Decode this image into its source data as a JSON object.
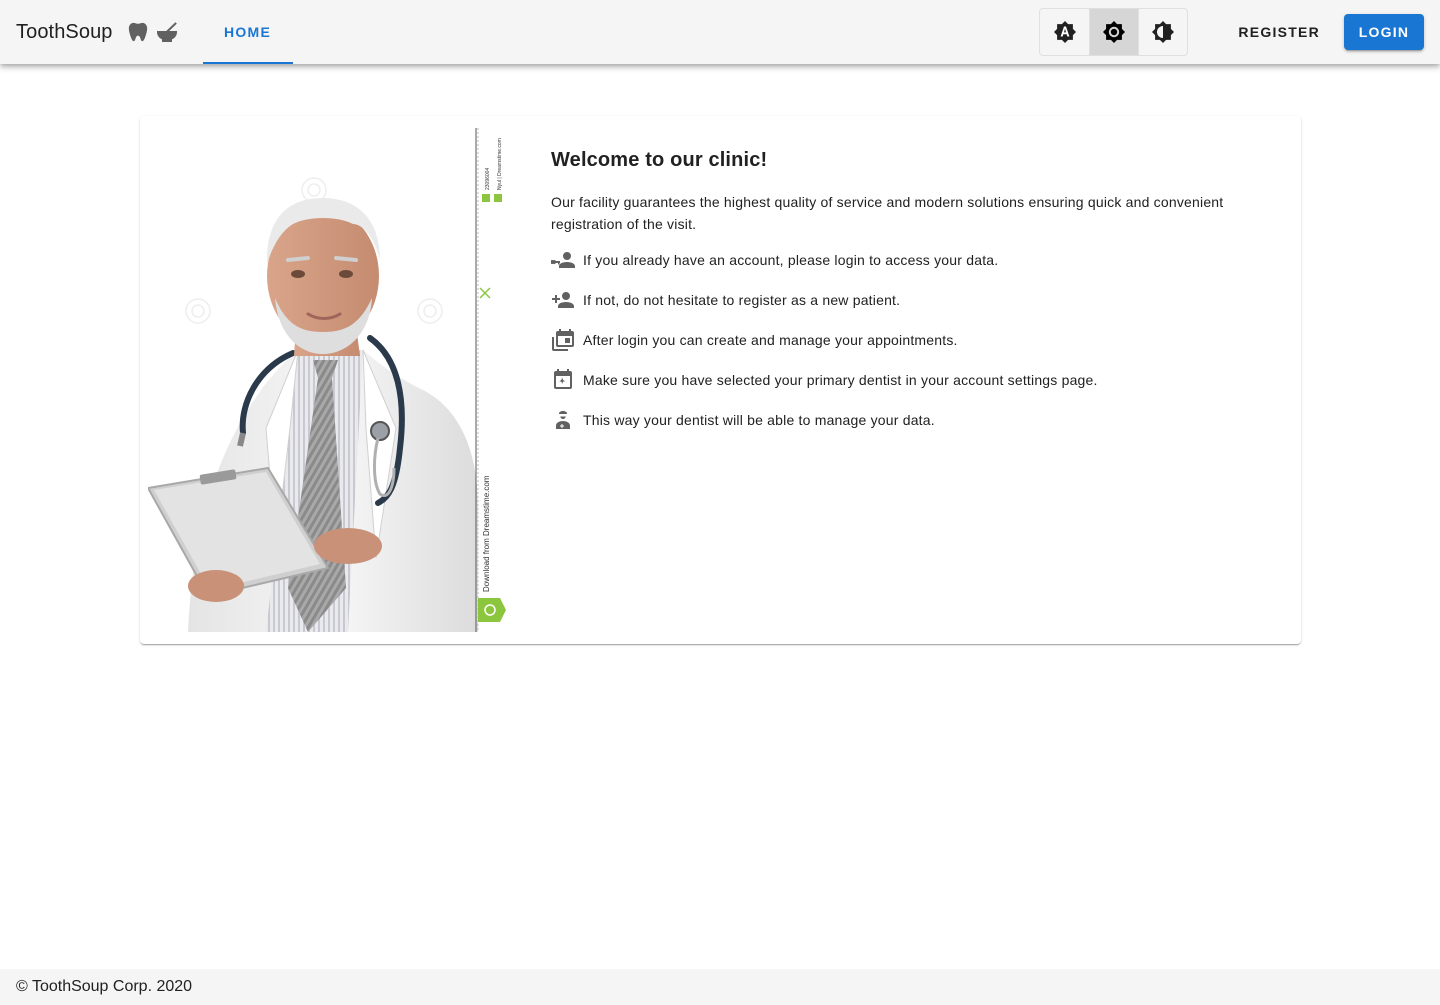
{
  "appbar": {
    "brand": "ToothSoup",
    "tabs": [
      {
        "label": "HOME",
        "active": true
      }
    ],
    "theme_options": [
      "auto",
      "light",
      "dark"
    ],
    "theme_selected": "light",
    "register_label": "REGISTER",
    "login_label": "LOGIN"
  },
  "welcome": {
    "title": "Welcome to our clinic!",
    "intro": "Our facility guarantees the highest quality of service and modern solutions ensuring quick and convenient registration of the visit.",
    "items": [
      {
        "icon": "account-key-icon",
        "text": "If you already have an account, please login to access your data."
      },
      {
        "icon": "account-plus-icon",
        "text": "If not, do not hesitate to register as a new patient."
      },
      {
        "icon": "calendar-multiple-icon",
        "text": "After login you can create and manage your appointments."
      },
      {
        "icon": "calendar-star-icon",
        "text": "Make sure you have selected your primary dentist in your account settings page."
      },
      {
        "icon": "doctor-icon",
        "text": "This way your dentist will be able to manage your data."
      }
    ]
  },
  "photo": {
    "watermark_text": "Download from Dreamstime.com",
    "watermark_id": "23096004",
    "watermark_credit": "Nyul | Dreamstime.com"
  },
  "footer": {
    "copyright": "© ToothSoup Corp. 2020"
  },
  "colors": {
    "primary": "#1976d2",
    "appbar_bg": "#f5f5f5",
    "icon_grey": "#616161",
    "watermark_green": "#8cc63f"
  }
}
